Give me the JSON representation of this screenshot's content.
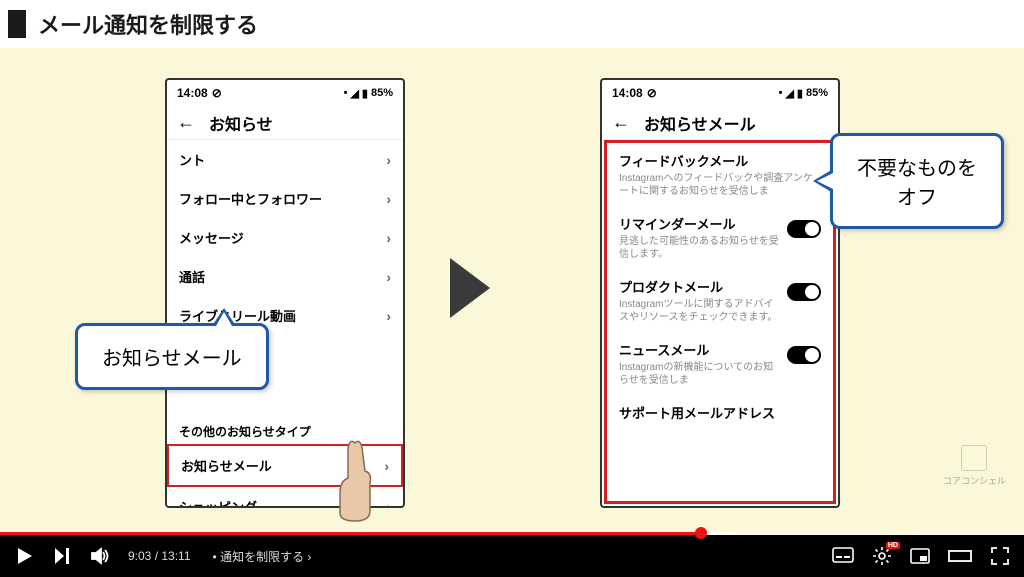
{
  "heading": "メール通知を制限する",
  "status_bar": {
    "time": "14:08",
    "battery": "85%"
  },
  "phone_left": {
    "title": "お知らせ",
    "items": [
      "ント",
      "フォロー中とフォロワー",
      "メッセージ",
      "通話",
      "ライブとリール動画"
    ],
    "section_header": "その他のお知らせタイプ",
    "highlighted_item": "お知らせメール",
    "bottom_item": "ショッピング"
  },
  "phone_right": {
    "title": "お知らせメール",
    "settings": [
      {
        "title": "フィードバックメール",
        "desc": "Instagramへのフィードバックや調査アンケートに関するお知らせを受信しま"
      },
      {
        "title": "リマインダーメール",
        "desc": "見逃した可能性のあるお知らせを受信します。"
      },
      {
        "title": "プロダクトメール",
        "desc": "Instagramツールに関するアドバイスやリソースをチェックできます。"
      },
      {
        "title": "ニュースメール",
        "desc": "Instagramの新機能についてのお知らせを受信しま"
      }
    ],
    "bottom_item": "サポート用メールアドレス"
  },
  "callout_left": "お知らせメール",
  "callout_right_line1": "不要なものを",
  "callout_right_line2": "オフ",
  "watermark": "コアコンシェル",
  "player": {
    "current": "9:03",
    "duration": "13:11",
    "chapter": "通知を制限する",
    "hd": "HD"
  }
}
